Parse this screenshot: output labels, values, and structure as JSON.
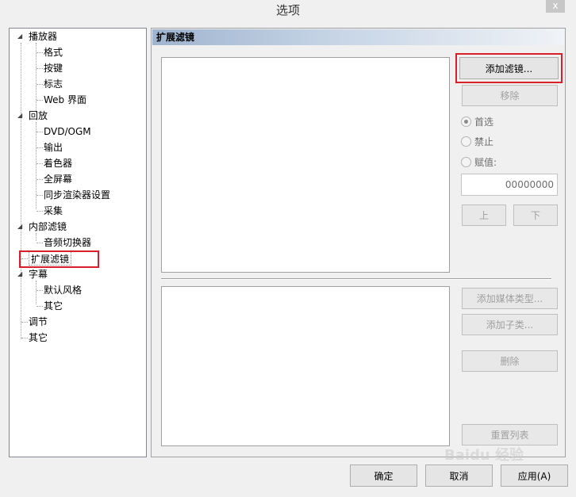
{
  "window": {
    "title": "选项",
    "close_label": "x"
  },
  "tree": {
    "items": [
      {
        "label": "播放器",
        "level": 0,
        "expanded": true
      },
      {
        "label": "格式",
        "level": 1
      },
      {
        "label": "按键",
        "level": 1
      },
      {
        "label": "标志",
        "level": 1
      },
      {
        "label": "Web 界面",
        "level": 1
      },
      {
        "label": "回放",
        "level": 0,
        "expanded": true
      },
      {
        "label": "DVD/OGM",
        "level": 1
      },
      {
        "label": "输出",
        "level": 1
      },
      {
        "label": "着色器",
        "level": 1
      },
      {
        "label": "全屏幕",
        "level": 1
      },
      {
        "label": "同步渲染器设置",
        "level": 1
      },
      {
        "label": "采集",
        "level": 1
      },
      {
        "label": "内部滤镜",
        "level": 0,
        "expanded": true
      },
      {
        "label": "音频切换器",
        "level": 1
      },
      {
        "label": "扩展滤镜",
        "level": 0,
        "selected": true
      },
      {
        "label": "字幕",
        "level": 0,
        "expanded": true
      },
      {
        "label": "默认风格",
        "level": 1
      },
      {
        "label": "其它",
        "level": 1
      },
      {
        "label": "调节",
        "level": 0
      },
      {
        "label": "其它",
        "level": 0
      }
    ]
  },
  "panel": {
    "title": "扩展滤镜",
    "add_filter_label": "添加滤镜...",
    "remove_label": "移除",
    "radio_prefer": "首选",
    "radio_block": "禁止",
    "radio_merit": "赋值:",
    "merit_value": "00000000",
    "up_label": "上",
    "down_label": "下",
    "add_media_type_label": "添加媒体类型...",
    "add_subtype_label": "添加子类...",
    "delete_label": "删除",
    "reset_list_label": "重置列表"
  },
  "footer": {
    "ok_label": "确定",
    "cancel_label": "取消",
    "apply_label": "应用(A)"
  },
  "watermark": {
    "text": "Baidu 经验"
  },
  "colors": {
    "highlight_red": "#d9202a",
    "header_gradient_start": "#9fb4cf"
  }
}
